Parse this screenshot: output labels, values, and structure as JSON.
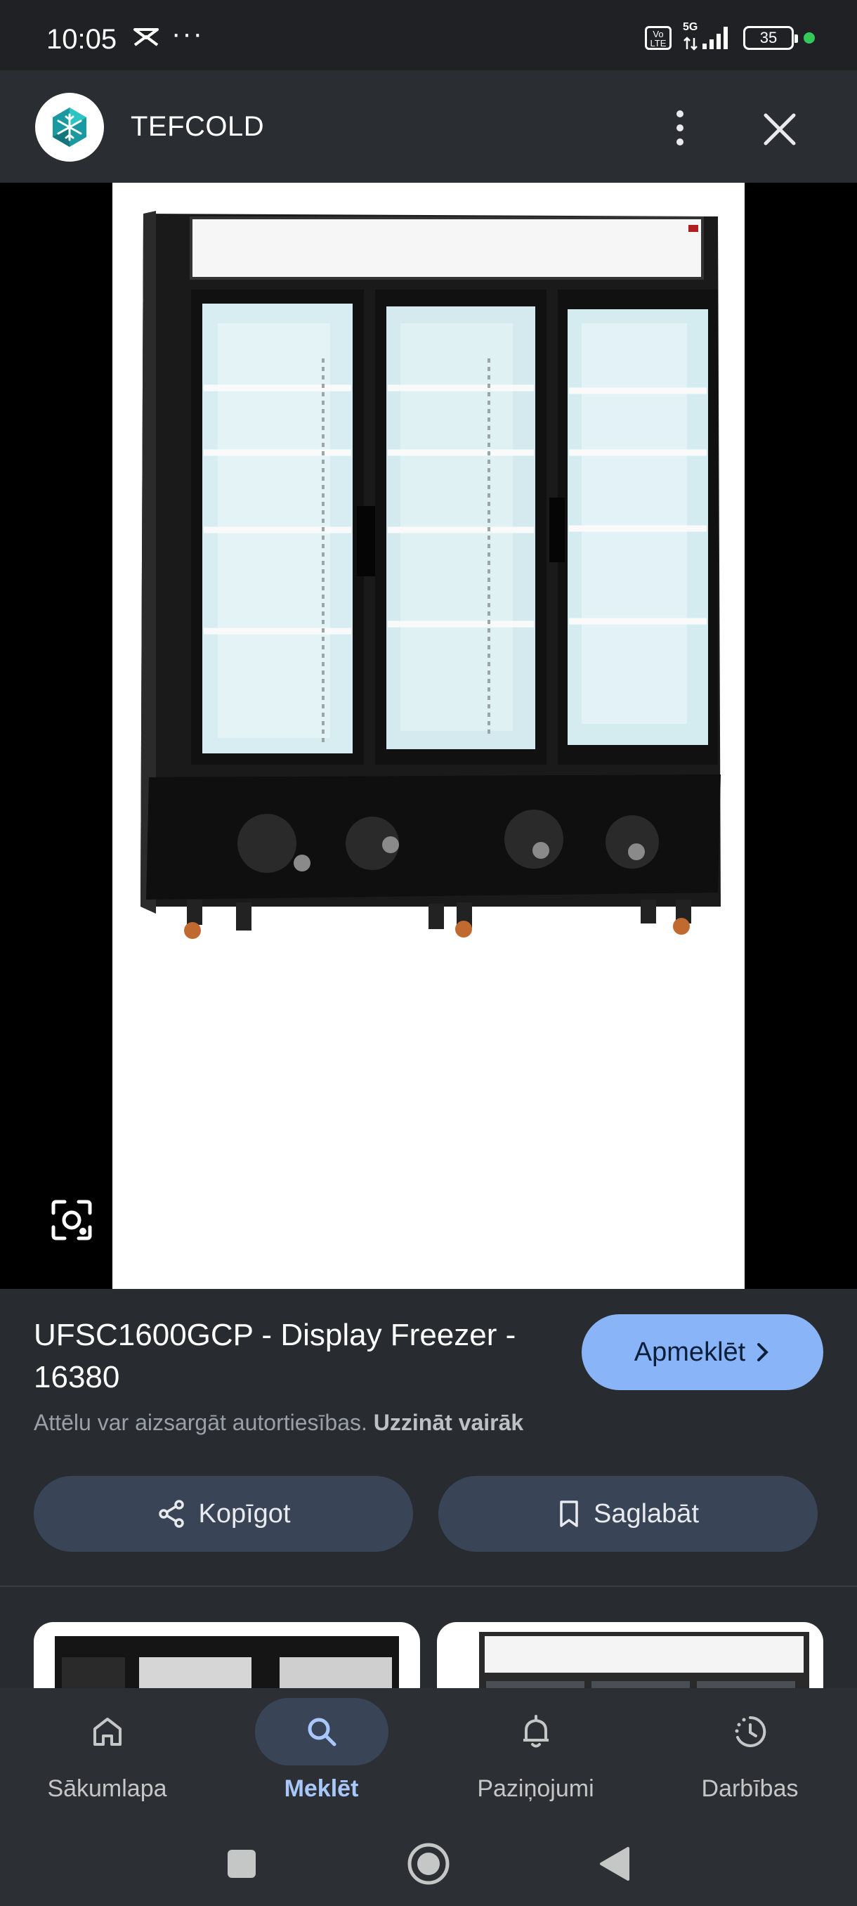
{
  "status_bar": {
    "time": "10:05",
    "more": "···",
    "network": "5G",
    "volte": "Vo LTE",
    "battery": "35",
    "icons": [
      "notification-icon",
      "signal-icon",
      "battery-icon",
      "privacy-dot-icon"
    ]
  },
  "header": {
    "site_name": "TEFCOLD",
    "logo_icon": "snowflake-logo-icon",
    "more_icon": "more-vert-icon",
    "close_icon": "close-icon"
  },
  "image": {
    "lens_icon": "google-lens-icon"
  },
  "result": {
    "title": "UFSC1600GCP - Display Freezer - 16380",
    "visit_label": "Apmeklēt",
    "copyright_text": "Attēlu var aizsargāt autortiesības.",
    "learn_more": "Uzzināt vairāk",
    "share_label": "Kopīgot",
    "save_label": "Saglabāt"
  },
  "bottom_nav": {
    "items": [
      {
        "label": "Sākumlapa",
        "icon": "home-icon",
        "active": false
      },
      {
        "label": "Meklēt",
        "icon": "search-icon",
        "active": true
      },
      {
        "label": "Paziņojumi",
        "icon": "bell-icon",
        "active": false
      },
      {
        "label": "Darbības",
        "icon": "activity-icon",
        "active": false
      }
    ]
  },
  "colors": {
    "accent": "#8ab4f8",
    "background": "#202124",
    "panel": "#282b30",
    "button": "#394457"
  }
}
